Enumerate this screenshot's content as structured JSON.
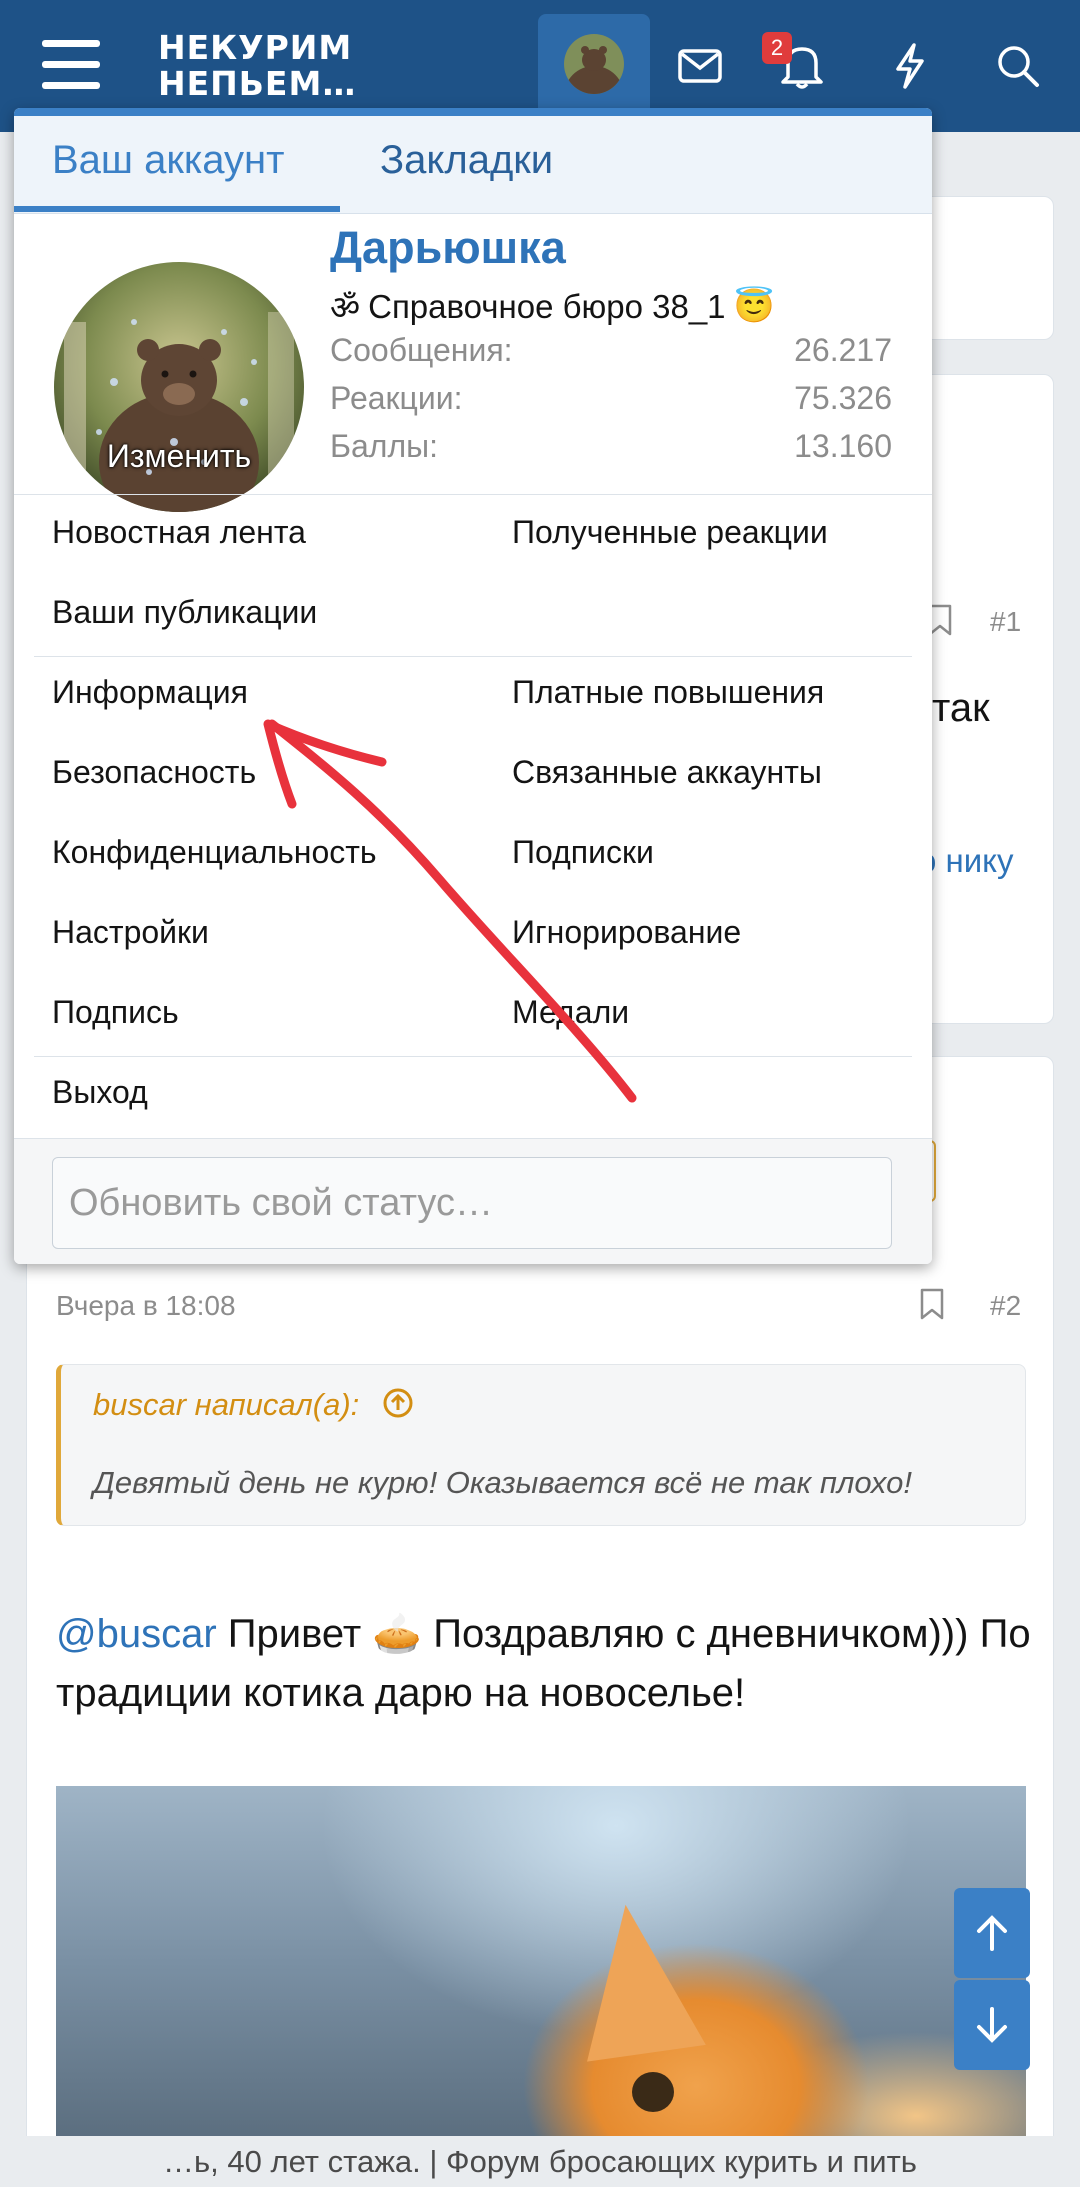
{
  "header": {
    "logo_line1": "НЕКУРИМ",
    "logo_line2": "НЕПЬЕМ…",
    "notification_count": "2",
    "icons": [
      "menu-icon",
      "envelope-icon",
      "bell-icon",
      "lightning-icon",
      "search-icon"
    ]
  },
  "account_menu": {
    "tabs": [
      "Ваш аккаунт",
      "Закладки"
    ],
    "active_tab": "Ваш аккаунт",
    "avatar_edit_label": "Изменить",
    "username": "Дарьюшка",
    "user_title_symbol": "ॐ",
    "user_title": "Справочное бюро 38_1",
    "user_title_emoji": "😇",
    "stats": [
      {
        "label": "Сообщения:",
        "value": "26.217"
      },
      {
        "label": "Реакции:",
        "value": "75.326"
      },
      {
        "label": "Баллы:",
        "value": "13.160"
      }
    ],
    "links_group1": [
      {
        "left": "Новостная лента",
        "right": "Полученные реакции"
      },
      {
        "left": "Ваши публикации",
        "right": ""
      }
    ],
    "links_group2": [
      {
        "left": "Информация",
        "right": "Платные повышения"
      },
      {
        "left": "Безопасность",
        "right": "Связанные аккаунты"
      },
      {
        "left": "Конфиденциальность",
        "right": "Подписки"
      },
      {
        "left": "Настройки",
        "right": "Игнорирование"
      },
      {
        "left": "Подпись",
        "right": "Медали"
      }
    ],
    "logout": "Выход",
    "status_placeholder": "Обновить свой статус…"
  },
  "background": {
    "post1_number": "#1",
    "partial_text_1": "так",
    "partial_text_2": "о нику",
    "post2_time": "Вчера в 18:08",
    "post2_number": "#2",
    "quote_author": "buscar написал(а):",
    "quote_text": "Девятый день не курю! Оказывается всё не так плохо!",
    "message_mention": "@buscar",
    "message_text": " Привет  🥧  Поздравляю с дневничком))) По традиции котика дарю на новоселье!",
    "footer": "…ь, 40 лет стажа. | Форум бросающих курить и пить"
  },
  "colors": {
    "header_bg": "#1e5287",
    "accent": "#3b80c6",
    "username": "#2e73b8",
    "quote_author": "#d38e12",
    "badge": "#e03c3c",
    "annotation_arrow": "#e8323c"
  }
}
